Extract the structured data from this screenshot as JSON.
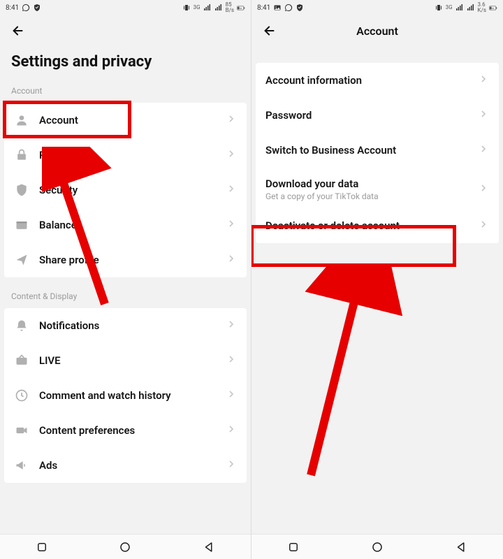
{
  "status": {
    "time": "8:41",
    "net_label_left": "3G",
    "net_speed_left_num": "85",
    "net_speed_left_unit": "B/s",
    "net_speed_right_num": "3.6",
    "net_speed_right_unit": "K/s",
    "battery_left": "22",
    "battery_right": "22"
  },
  "left": {
    "page_title": "Settings and privacy",
    "section_account": "Account",
    "items_account": [
      {
        "label": "Account"
      },
      {
        "label": "Privacy"
      },
      {
        "label": "Security"
      },
      {
        "label": "Balance"
      },
      {
        "label": "Share profile"
      }
    ],
    "section_content": "Content & Display",
    "items_content": [
      {
        "label": "Notifications"
      },
      {
        "label": "LIVE"
      },
      {
        "label": "Comment and watch history"
      },
      {
        "label": "Content preferences"
      },
      {
        "label": "Ads"
      }
    ]
  },
  "right": {
    "header_title": "Account",
    "items": [
      {
        "label": "Account information"
      },
      {
        "label": "Password"
      },
      {
        "label": "Switch to Business Account"
      },
      {
        "label": "Download your data",
        "sub": "Get a copy of your TikTok data"
      },
      {
        "label": "Deactivate or delete account"
      }
    ]
  },
  "annotations": {
    "highlight_left": "account-row",
    "highlight_right": "deactivate-row"
  }
}
